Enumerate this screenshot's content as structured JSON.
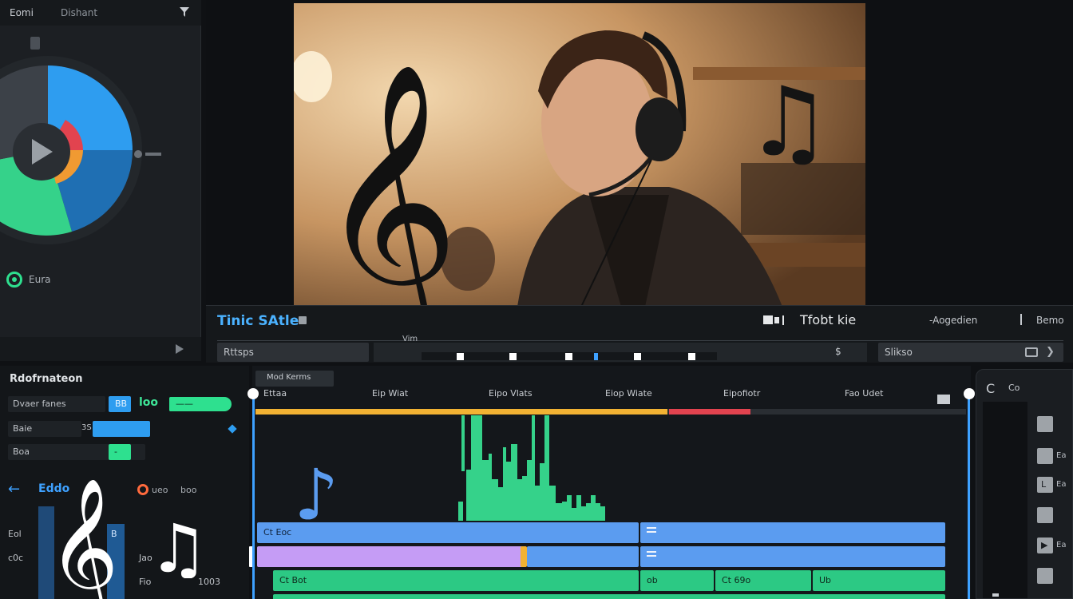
{
  "left_panel": {
    "title": "Eomi",
    "tab": "Dishant",
    "status_label": "Eura"
  },
  "transport": {
    "clip_title": "Tinic SAtle",
    "center_label": "Tfobt kie",
    "right_label_1": "-Aogedien",
    "right_label_2": "Bemo",
    "ruler_marker": "Vim",
    "field_left": "Rttsps",
    "scrub_end": "$",
    "field_right": "Slikso"
  },
  "info_panel": {
    "title": "Rdofrnateon",
    "rows": [
      {
        "label": "Dvaer fanes",
        "value": "BB",
        "tag": "loo",
        "pill": "——"
      },
      {
        "label": "Baie",
        "mid": "3S",
        "value": ""
      },
      {
        "label": "Boa",
        "value": "-"
      }
    ],
    "back_label": "Eddo",
    "rec_label": "ueo",
    "rec_label_2": "boo",
    "bottom_labels": [
      "Eol",
      "c0c",
      "Jao",
      "Fio",
      "1003"
    ],
    "meter_value": "B"
  },
  "timeline": {
    "tab_label": "Mod Kerms",
    "marks": [
      "Ettaa",
      "Eip Wiat",
      "Eipo Vlats",
      "Eiop Wiate",
      "Eipofiotr",
      "Fao Udet"
    ],
    "tracks": {
      "blue_1": "Ct Eoc",
      "purple": "",
      "green_1": "Ct Bot",
      "green_2": "ob",
      "green_3": "Ct 69o",
      "green_4": "Ub"
    }
  },
  "mixer": {
    "top_icon": "C",
    "top_label": "Co",
    "buttons": [
      "",
      "",
      "L",
      "",
      "",
      ""
    ],
    "sides": [
      "",
      "Ea",
      "Ea",
      "",
      "Ea",
      ""
    ]
  },
  "colors": {
    "accent_blue": "#3ea1ff",
    "accent_green": "#2ee08f",
    "track_blue": "#5b9cf0",
    "track_purple": "#c59cf5",
    "track_green": "#2cc984",
    "bar_yellow": "#f2b233",
    "bar_red": "#e2434f"
  },
  "icons": [
    "funnel-icon",
    "play-icon",
    "treble-clef-icon",
    "eighth-notes-icon",
    "back-arrow-icon",
    "record-icon"
  ]
}
